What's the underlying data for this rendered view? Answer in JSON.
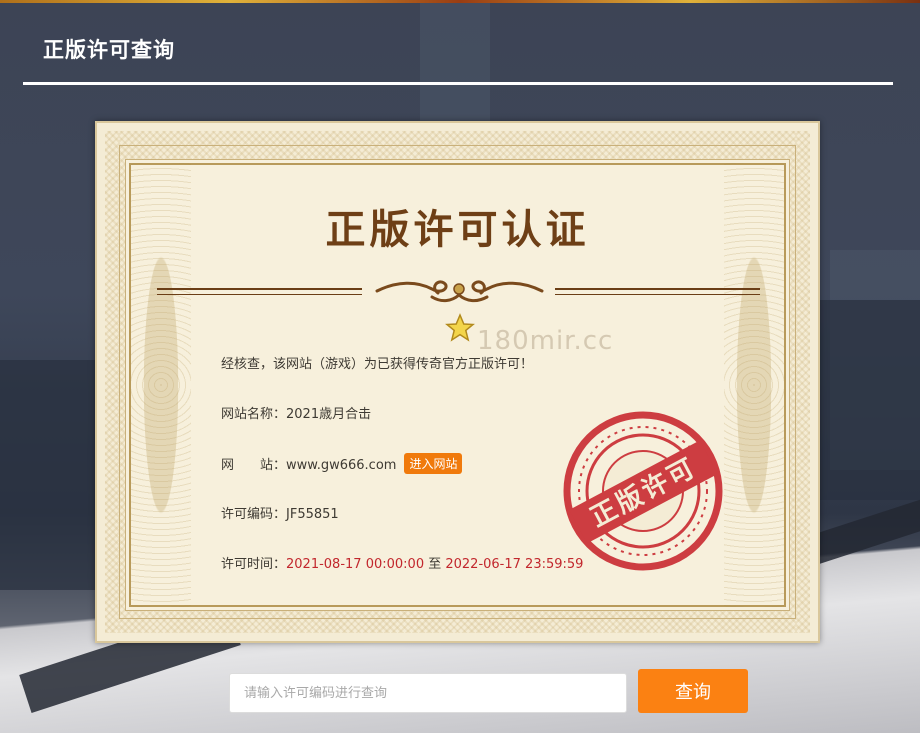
{
  "header": {
    "title": "正版许可查询"
  },
  "certificate": {
    "title": "正版许可认证",
    "watermark": "180mir.cc",
    "verify_text": "经核查，该网站（游戏）为已获得传奇官方正版许可！",
    "site_name_label": "网站名称：",
    "site_name_value": "2021歳月合击",
    "website_label": "网　　站：",
    "website_value": "www.gw666.com",
    "visit_button": "进入网站",
    "license_code_label": "许可编码：",
    "license_code_value": "JF55851",
    "license_time_label": "许可时间：",
    "license_time_start": "2021-08-17 00:00:00",
    "license_time_sep": " 至 ",
    "license_time_end": "2022-06-17 23:59:59",
    "stamp_text": "正版许可"
  },
  "search": {
    "placeholder": "请输入许可编码进行查询",
    "button_label": "查询"
  },
  "colors": {
    "accent_orange": "#fb8112",
    "stamp_red": "#c8252c",
    "title_brown": "#6e3f16",
    "date_red": "#c2272d"
  }
}
